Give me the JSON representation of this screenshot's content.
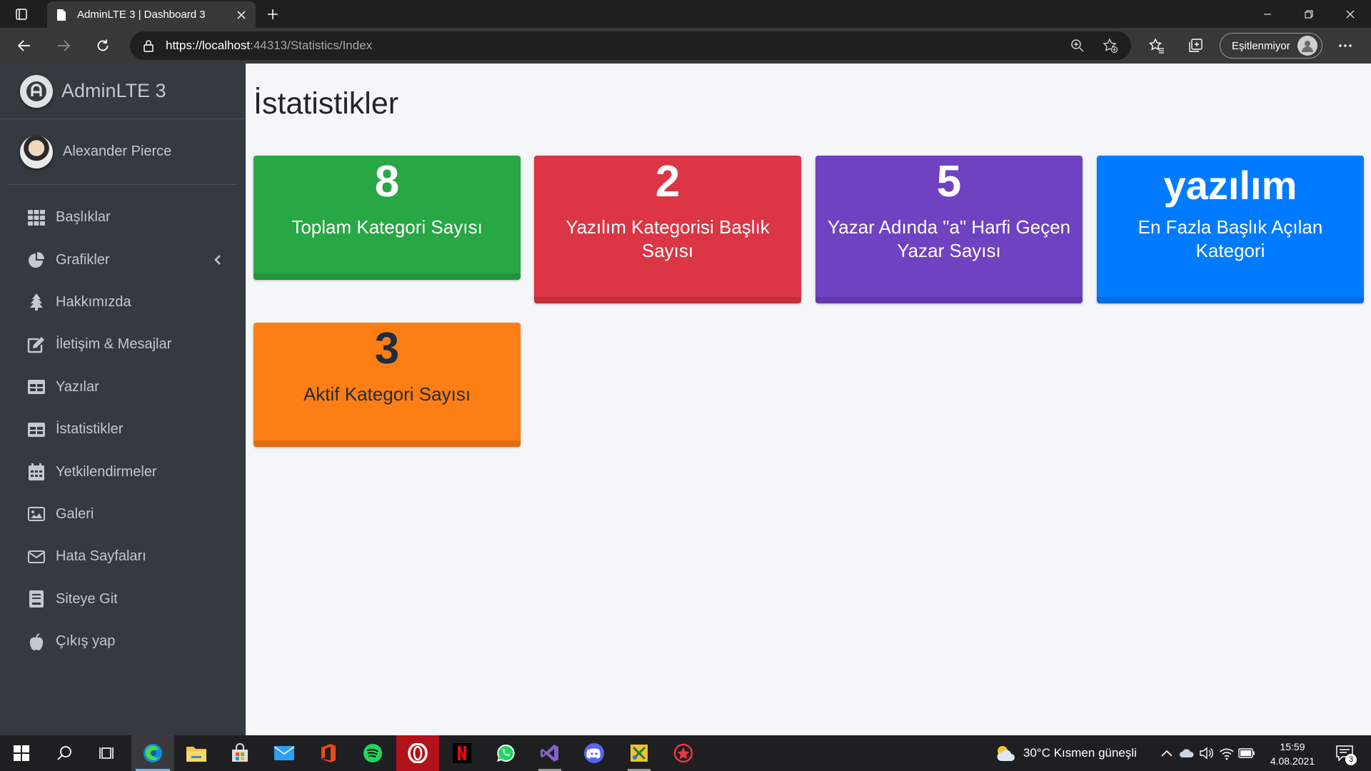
{
  "browser": {
    "tab_title": "AdminLTE 3 | Dashboard 3",
    "url_host": "https://localhost",
    "url_rest": ":44313/Statistics/Index",
    "sync_label": "Eşitlenmiyor"
  },
  "sidebar": {
    "brand": "AdminLTE 3",
    "user": "Alexander Pierce",
    "items": [
      {
        "label": "Başlıklar",
        "icon": "grid-icon"
      },
      {
        "label": "Grafikler",
        "icon": "pie-chart-icon"
      },
      {
        "label": "Hakkımızda",
        "icon": "tree-icon"
      },
      {
        "label": "İletişim & Mesajlar",
        "icon": "edit-icon"
      },
      {
        "label": "Yazılar",
        "icon": "table-icon"
      },
      {
        "label": "İstatistikler",
        "icon": "table-icon"
      },
      {
        "label": "Yetkilendirmeler",
        "icon": "calendar-icon"
      },
      {
        "label": "Galeri",
        "icon": "image-icon"
      },
      {
        "label": "Hata Sayfaları",
        "icon": "envelope-icon"
      },
      {
        "label": "Siteye Git",
        "icon": "book-icon"
      },
      {
        "label": "Çıkış yap",
        "icon": "apple-icon"
      }
    ]
  },
  "main": {
    "title": "İstatistikler",
    "boxes": [
      {
        "value": "8",
        "label": "Toplam Kategori Sayısı",
        "color": "#28a745"
      },
      {
        "value": "2",
        "label": "Yazılım Kategorisi Başlık Sayısı",
        "color": "#dc3545"
      },
      {
        "value": "5",
        "label": "Yazar Adında \"a\" Harfi Geçen Yazar Sayısı",
        "color": "#6f42c1"
      },
      {
        "value": "yazılım",
        "label": "En Fazla Başlık Açılan Kategori",
        "color": "#007bff"
      },
      {
        "value": "3",
        "label": "Aktif Kategori Sayısı",
        "color": "#fd7e14"
      }
    ]
  },
  "taskbar": {
    "weather": "30°C  Kısmen güneşli",
    "time": "15:59",
    "date": "4.08.2021",
    "notifications": "3"
  }
}
